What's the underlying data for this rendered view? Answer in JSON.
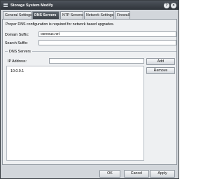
{
  "window": {
    "title": "Storage System Modify",
    "help_icon": "help-icon",
    "close_icon": "close-icon"
  },
  "tabs": [
    {
      "label": "General Settings",
      "active": false
    },
    {
      "label": "DNS Servers",
      "active": true
    },
    {
      "label": "NTP Servers",
      "active": false
    },
    {
      "label": "Network Settings",
      "active": false
    },
    {
      "label": "Firewall",
      "active": false
    }
  ],
  "dns": {
    "info_text": "Proper DNS configuration is required for network based upgrades.",
    "domain_suffix_label": "Domain Suffix:",
    "domain_suffix_value": "osnexus.net",
    "search_suffix_label": "Search Suffix:",
    "search_suffix_value": "",
    "servers_legend": "DNS Servers",
    "ip_address_label": "IP Address:",
    "ip_address_value": "",
    "add_label": "Add",
    "remove_label": "Remove",
    "servers": [
      "10.0.0.1"
    ]
  },
  "footer": {
    "ok_label": "OK",
    "cancel_label": "Cancel",
    "apply_label": "Apply"
  },
  "colors": {
    "titlebar": "#2f343a",
    "active_tab": "#3a4047",
    "panel": "#eef0f2"
  }
}
